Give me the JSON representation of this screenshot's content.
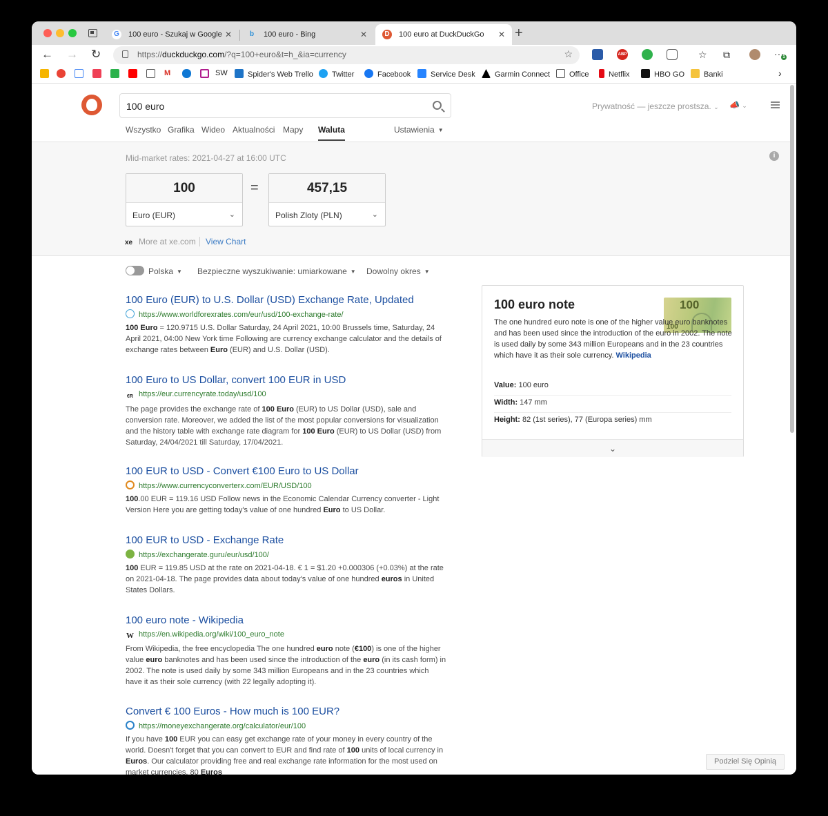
{
  "browser": {
    "tabs": [
      {
        "label": "100 euro - Szukaj w Google",
        "favicon": "G"
      },
      {
        "label": "100 euro - Bing",
        "favicon": "b"
      },
      {
        "label": "100 euro at DuckDuckGo",
        "favicon": "D"
      }
    ],
    "url_prefix": "https://",
    "url_host": "duckduckgo.com",
    "url_rest": "/?q=100+euro&t=h_&ia=currency",
    "bookmarks": [
      "SW",
      "Spider's Web Trello",
      "Twitter",
      "Facebook",
      "Service Desk",
      "Garmin Connect",
      "Office",
      "Netflix",
      "HBO GO",
      "Banki"
    ],
    "ext_badge": "1",
    "ext_abp": "ABP"
  },
  "search": {
    "query": "100 euro",
    "privacy_text": "Prywatność — jeszcze prostsza.",
    "tabs": [
      "Wszystko",
      "Grafika",
      "Wideo",
      "Aktualności",
      "Mapy",
      "Waluta"
    ],
    "settings": "Ustawienia"
  },
  "currency": {
    "mid_rates": "Mid-market rates: 2021-04-27 at 16:00 UTC",
    "from_amount": "100",
    "from_currency": "Euro (EUR)",
    "equals": "=",
    "to_amount": "457,15",
    "to_currency": "Polish Zloty (PLN)",
    "xe_logo": "xe",
    "xe_link": "More at xe.com",
    "view_chart": "View Chart"
  },
  "filters": {
    "region": "Polska",
    "safe_search": "Bezpieczne wyszukiwanie: umiarkowane",
    "time": "Dowolny okres"
  },
  "results": [
    {
      "title": "100 Euro (EUR) to U.S. Dollar (USD) Exchange Rate, Updated",
      "url": "https://www.worldforexrates.com/eur/usd/100-exchange-rate/",
      "snippet_html": "<b>100 Euro</b> = 120.9715 U.S. Dollar Saturday, 24 April 2021, 10:00 Brussels time, Saturday, 24 April 2021, 04:00 New York time Following are currency exchange calculator and the details of exchange rates between <b>Euro</b> (EUR) and U.S. Dollar (USD)."
    },
    {
      "title": "100 Euro to US Dollar, convert 100 EUR in USD",
      "url": "https://eur.currencyrate.today/usd/100",
      "snippet_html": "The page provides the exchange rate of <b>100 Euro</b> (EUR) to US Dollar (USD), sale and conversion rate. Moreover, we added the list of the most popular conversions for visualization and the history table with exchange rate diagram for <b>100 Euro</b> (EUR) to US Dollar (USD) from Saturday, 24/04/2021 till Saturday, 17/04/2021."
    },
    {
      "title": "100 EUR to USD - Convert €100 Euro to US Dollar",
      "url": "https://www.currencyconverterx.com/EUR/USD/100",
      "snippet_html": "<b>100</b>.00 EUR = 119.16 USD Follow news in the Economic Calendar Currency converter - Light Version Here you are getting today's value of one hundred <b>Euro</b> to US Dollar."
    },
    {
      "title": "100 EUR to USD - Exchange Rate",
      "url": "https://exchangerate.guru/eur/usd/100/",
      "snippet_html": "<b>100</b> EUR = 119.85 USD at the rate on 2021-04-18. € 1 = $1.20 +0.000306 (+0.03%) at the rate on 2021-04-18. The page provides data about today's value of one hundred <b>euros</b> in United States Dollars."
    },
    {
      "title": "100 euro note - Wikipedia",
      "url": "https://en.wikipedia.org/wiki/100_euro_note",
      "snippet_html": "From Wikipedia, the free encyclopedia The one hundred <b>euro</b> note (<b>€100</b>) is one of the higher value <b>euro</b> banknotes and has been used since the introduction of the <b>euro</b> (in its cash form) in 2002. The note is used daily by some 343 million Europeans and in the 23 countries which have it as their sole currency (with 22 legally adopting it)."
    },
    {
      "title": "Convert € 100 Euros - How much is 100 EUR?",
      "url": "https://moneyexchangerate.org/calculator/eur/100",
      "snippet_html": "If you have <b>100</b> EUR you can easy get exchange rate of your money in every country of the world. Doesn't forget that you can convert to EUR and find rate of <b>100</b> units of local currency in <b>Euros</b>. Our calculator providing free and real exchange rate information for the most used on market currencies. 80 <b>Euros</b>"
    }
  ],
  "panel": {
    "title": "100 euro note",
    "description": "The one hundred euro note is one of the higher value euro banknotes and has been used since the introduction of the euro in 2002. The note is used daily by some 343 million Europeans and in the 23 countries which have it as their sole currency.",
    "wiki_link": "Wikipedia",
    "note_value_big": "100",
    "note_value_small": "100",
    "rows": [
      {
        "label": "Value:",
        "value": "100 euro"
      },
      {
        "label": "Width:",
        "value": "147 mm"
      },
      {
        "label": "Height:",
        "value": "82 (1st series), 77 (Europa series) mm"
      }
    ]
  },
  "feedback": "Podziel Się Opinią",
  "colors": {
    "ddg": "#de5833",
    "link": "#1c4fa0",
    "url": "#2c7a2c"
  }
}
